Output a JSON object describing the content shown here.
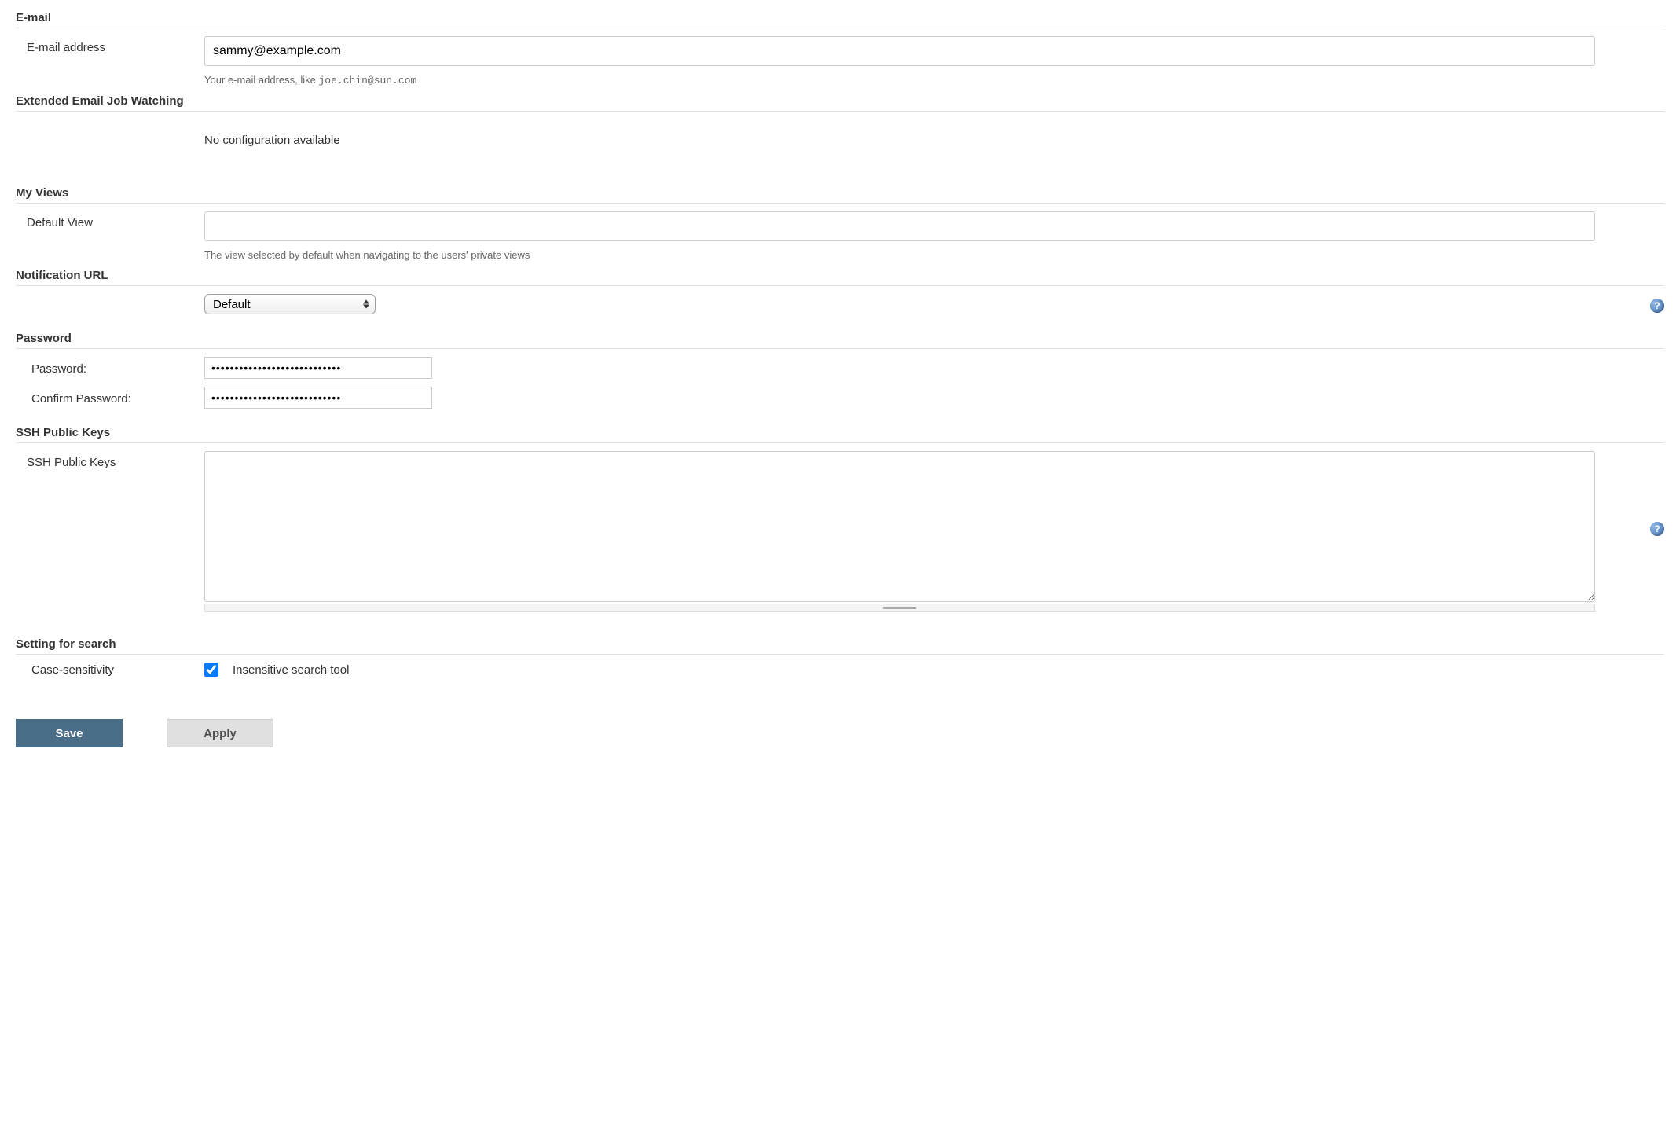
{
  "sections": {
    "email": {
      "header": "E-mail",
      "address_label": "E-mail address",
      "address_value": "sammy@example.com",
      "help_prefix": "Your e-mail address, like ",
      "help_example": "joe.chin@sun.com"
    },
    "extended_email": {
      "header": "Extended Email Job Watching",
      "message": "No configuration available"
    },
    "my_views": {
      "header": "My Views",
      "default_view_label": "Default View",
      "default_view_value": "",
      "help": "The view selected by default when navigating to the users' private views"
    },
    "notification_url": {
      "header": "Notification URL",
      "selected": "Default"
    },
    "password": {
      "header": "Password",
      "password_label": "Password:",
      "confirm_label": "Confirm Password:",
      "password_value": "••••••••••••••••••••••••••••",
      "confirm_value": "••••••••••••••••••••••••••••"
    },
    "ssh": {
      "header": "SSH Public Keys",
      "field_label": "SSH Public Keys",
      "value": ""
    },
    "search": {
      "header": "Setting for search",
      "case_label": "Case-sensitivity",
      "checkbox_label": "Insensitive search tool",
      "checked": true
    }
  },
  "buttons": {
    "save": "Save",
    "apply": "Apply"
  }
}
